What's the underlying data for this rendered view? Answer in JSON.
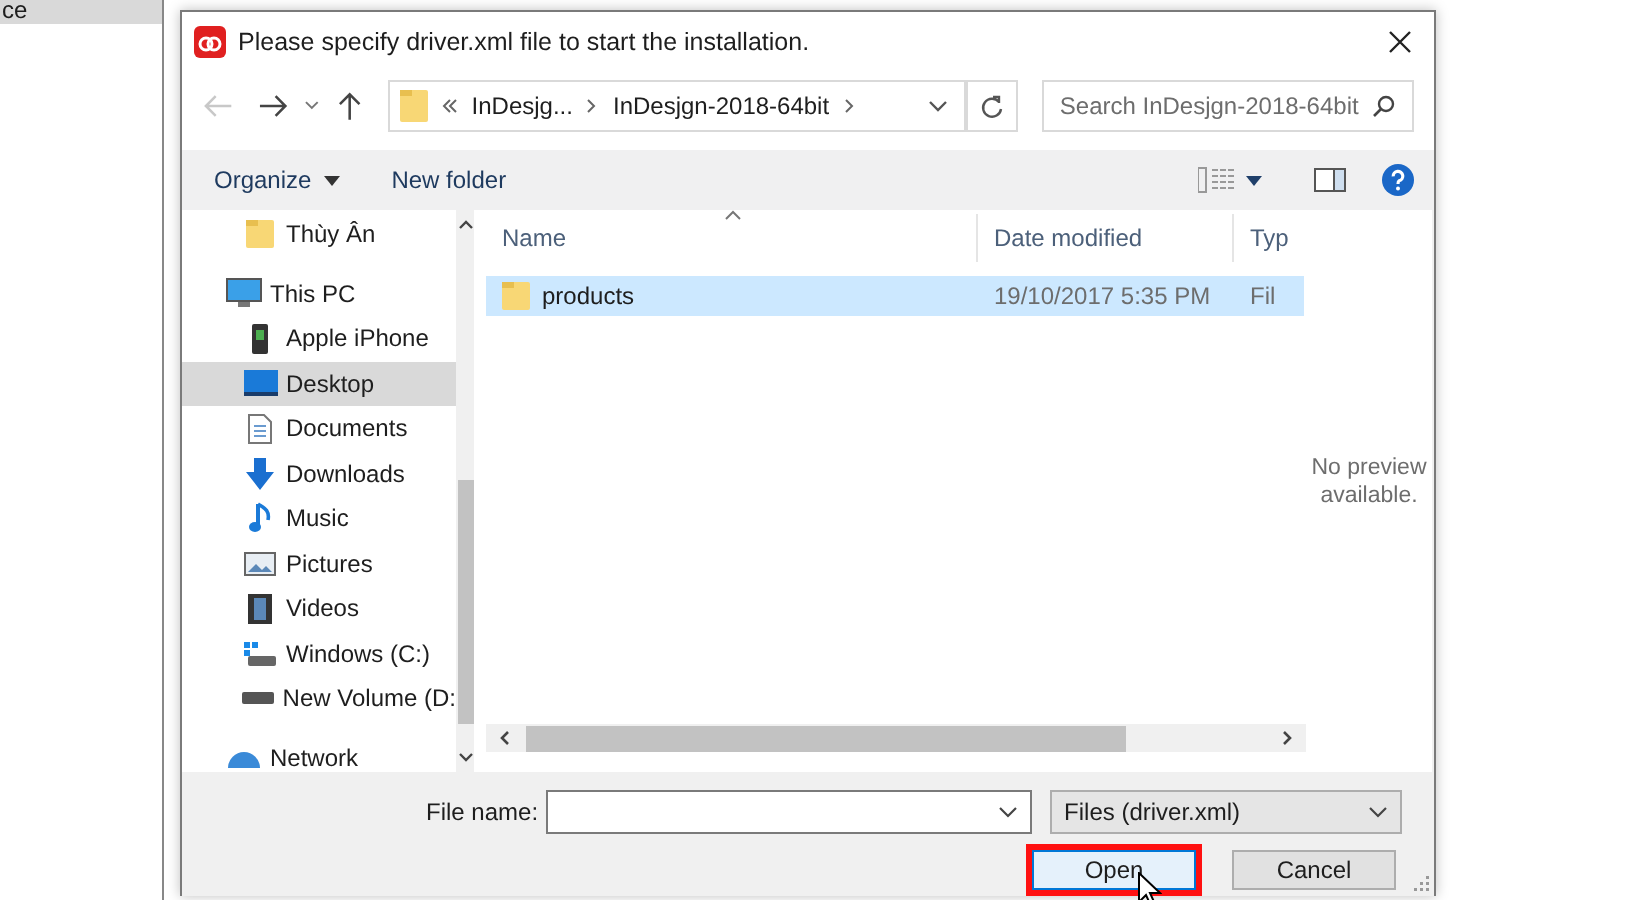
{
  "background_window": {
    "item": "ce"
  },
  "dialog": {
    "title": "Please specify driver.xml file to start the installation.",
    "nav": {
      "back": {
        "disabled": true
      },
      "forward": {
        "disabled": false
      },
      "up": {
        "disabled": false
      }
    },
    "address": {
      "crumbs": [
        "InDesjg...",
        "InDesjgn-2018-64bit"
      ]
    },
    "search": {
      "placeholder": "Search InDesjgn-2018-64bit"
    },
    "toolbar": {
      "organize": "Organize",
      "new_folder": "New folder"
    },
    "sidebar": {
      "tree": [
        {
          "children": [
            {
              "label": "Thùy Ân",
              "kind": "folder",
              "selected": false
            }
          ]
        },
        {
          "label": "This PC",
          "kind": "pc",
          "selected": false,
          "children": [
            {
              "label": "Apple iPhone",
              "kind": "phone",
              "selected": false
            },
            {
              "label": "Desktop",
              "kind": "desktop",
              "selected": true
            },
            {
              "label": "Documents",
              "kind": "documents",
              "selected": false
            },
            {
              "label": "Downloads",
              "kind": "downloads",
              "selected": false
            },
            {
              "label": "Music",
              "kind": "music",
              "selected": false
            },
            {
              "label": "Pictures",
              "kind": "pictures",
              "selected": false
            },
            {
              "label": "Videos",
              "kind": "videos",
              "selected": false
            },
            {
              "label": "Windows (C:)",
              "kind": "system-drive",
              "selected": false
            },
            {
              "label": "New Volume (D:",
              "kind": "drive",
              "selected": false
            }
          ]
        },
        {
          "label": "Network",
          "kind": "network",
          "selected": false
        }
      ]
    },
    "columns": [
      {
        "label": "Name",
        "sorted": true
      },
      {
        "label": "Date modified",
        "sorted": false
      },
      {
        "label": "Typ",
        "sorted": false
      }
    ],
    "rows": [
      {
        "name": "products",
        "date": "19/10/2017 5:35 PM",
        "type": "Fil",
        "selected": true
      }
    ],
    "preview": "No preview available.",
    "file_name": {
      "label": "File name:"
    },
    "filter": {
      "value": "Files (driver.xml)"
    },
    "buttons": [
      {
        "label": "Open",
        "default": true,
        "highlighted": true
      },
      {
        "label": "Cancel",
        "default": false,
        "highlighted": false
      }
    ]
  }
}
